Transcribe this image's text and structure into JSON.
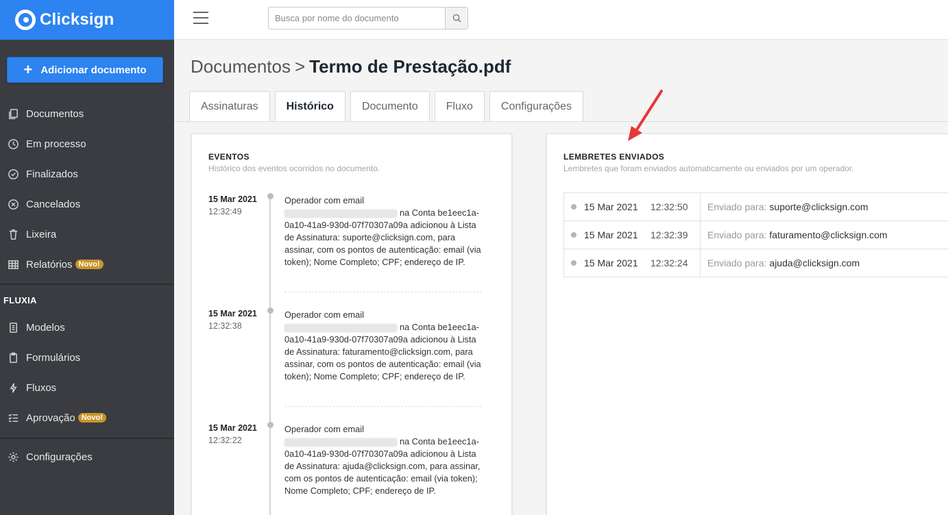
{
  "brand": {
    "name": "Clicksign"
  },
  "sidebar": {
    "add_button": "Adicionar documento",
    "items": [
      {
        "label": "Documentos",
        "icon": "documents-icon"
      },
      {
        "label": "Em processo",
        "icon": "clock-icon"
      },
      {
        "label": "Finalizados",
        "icon": "check-circle-icon"
      },
      {
        "label": "Cancelados",
        "icon": "x-circle-icon"
      },
      {
        "label": "Lixeira",
        "icon": "trash-icon"
      },
      {
        "label": "Relatórios",
        "icon": "table-icon",
        "badge": "Novo!"
      }
    ],
    "section_title": "FLUXIA",
    "fluxia_items": [
      {
        "label": "Modelos",
        "icon": "template-icon"
      },
      {
        "label": "Formulários",
        "icon": "clipboard-icon"
      },
      {
        "label": "Fluxos",
        "icon": "bolt-icon"
      },
      {
        "label": "Aprovação",
        "icon": "checklist-icon",
        "badge": "Novo!"
      }
    ],
    "settings": {
      "label": "Configurações",
      "icon": "gear-icon"
    }
  },
  "search": {
    "placeholder": "Busca por nome do documento"
  },
  "breadcrumb": {
    "root": "Documentos",
    "separator": ">",
    "document": "Termo de Prestação.pdf"
  },
  "tabs": [
    "Assinaturas",
    "Histórico",
    "Documento",
    "Fluxo",
    "Configurações"
  ],
  "active_tab": "Histórico",
  "events_card": {
    "title": "EVENTOS",
    "subtitle": "Histórico dos eventos ocorridos no documento.",
    "events": [
      {
        "date": "15 Mar 2021",
        "time": "12:32:49",
        "line1": "Operador com email",
        "text": "na Conta be1eec1a-0a10-41a9-930d-07f70307a09a adicionou à Lista de Assinatura: suporte@clicksign.com, para assinar, com os pontos de autenticação: email (via token); Nome Completo; CPF; endereço de IP."
      },
      {
        "date": "15 Mar 2021",
        "time": "12:32:38",
        "line1": "Operador com email",
        "text": "na Conta be1eec1a-0a10-41a9-930d-07f70307a09a adicionou à Lista de Assinatura: faturamento@clicksign.com, para assinar, com os pontos de autenticação: email (via token); Nome Completo; CPF; endereço de IP."
      },
      {
        "date": "15 Mar 2021",
        "time": "12:32:22",
        "line1": "Operador com email",
        "text": "na Conta be1eec1a-0a10-41a9-930d-07f70307a09a adicionou à Lista de Assinatura: ajuda@clicksign.com, para assinar, com os pontos de autenticação: email (via token); Nome Completo; CPF; endereço de IP."
      }
    ]
  },
  "reminders_card": {
    "title": "LEMBRETES ENVIADOS",
    "subtitle": "Lembretes que foram enviados automaticamente ou enviados por um operador.",
    "sent_to_label": "Enviado para:",
    "reminders": [
      {
        "date": "15 Mar 2021",
        "time": "12:32:50",
        "email": "suporte@clicksign.com"
      },
      {
        "date": "15 Mar 2021",
        "time": "12:32:39",
        "email": "faturamento@clicksign.com"
      },
      {
        "date": "15 Mar 2021",
        "time": "12:32:24",
        "email": "ajuda@clicksign.com"
      }
    ]
  },
  "colors": {
    "brand_blue": "#2d83f0",
    "sidebar": "#3a3c41",
    "badge": "#c9942a",
    "arrow": "#e53935"
  }
}
